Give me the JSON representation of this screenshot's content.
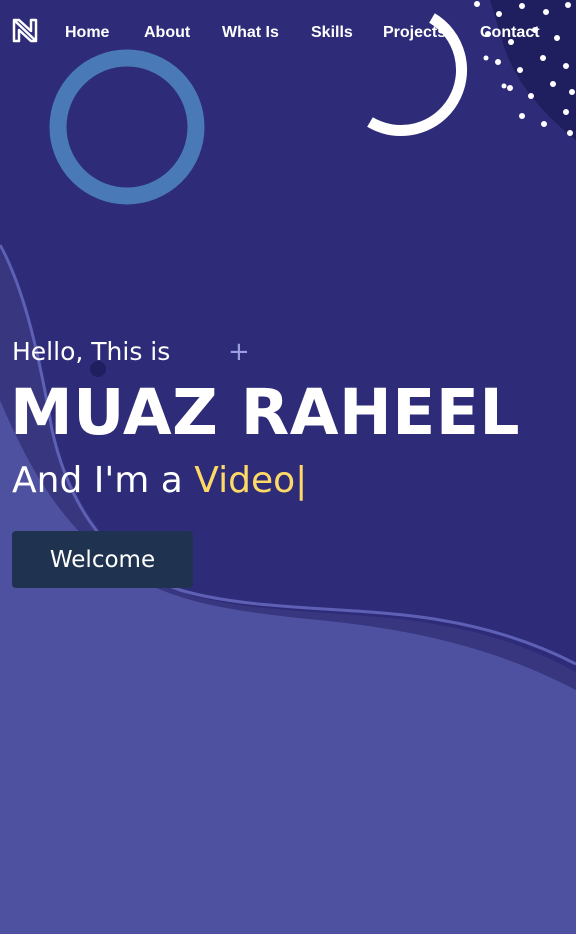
{
  "nav": {
    "logo_icon": "n-logo-icon",
    "items": [
      {
        "label": "Home"
      },
      {
        "label": "About"
      },
      {
        "label": "What Is"
      },
      {
        "label": "Skills"
      },
      {
        "label": "Projects"
      },
      {
        "label": "Contact"
      }
    ]
  },
  "hero": {
    "greeting": "Hello, This is",
    "name": "MUAZ RAHEEL",
    "role_prefix": "And I'm a ",
    "role_typed": "Video",
    "cursor": "|",
    "button_label": "Welcome",
    "plus_icon": "plus-icon"
  },
  "colors": {
    "top_background": "#2e2c78",
    "bottom_background": "#4e50a0",
    "accent_yellow": "#ffd966",
    "ring_blue": "#4a79b8",
    "button_background": "#1f3350"
  }
}
